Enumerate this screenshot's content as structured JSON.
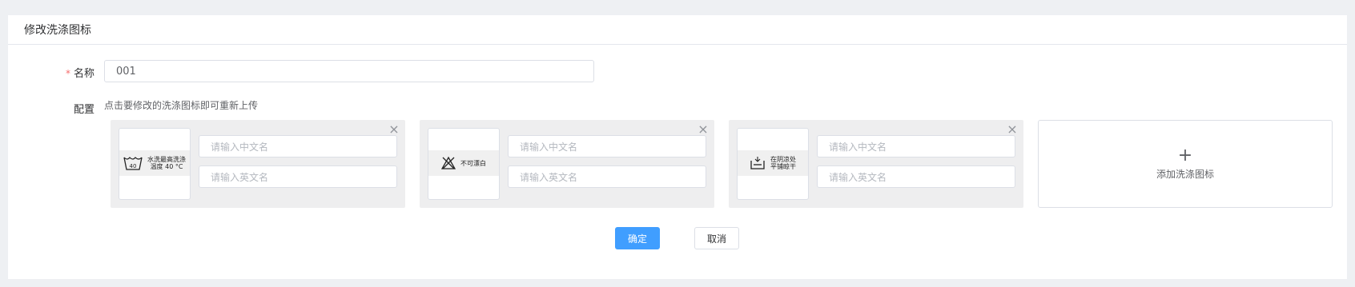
{
  "header": {
    "title": "修改洗涤图标"
  },
  "form": {
    "name_label": "名称",
    "required_mark": "*",
    "name_value": "001",
    "config_label": "配置",
    "config_hint": "点击要修改的洗涤图标即可重新上传"
  },
  "cards": [
    {
      "icon": "wash-40-icon",
      "icon_text_line1": "水洗最高洗涤",
      "icon_text_line2": "温度 40 °C",
      "icon_number": "40",
      "cn_placeholder": "请输入中文名",
      "en_placeholder": "请输入英文名"
    },
    {
      "icon": "no-bleach-icon",
      "icon_text_line1": "不可漂白",
      "icon_text_line2": "",
      "cn_placeholder": "请输入中文名",
      "en_placeholder": "请输入英文名"
    },
    {
      "icon": "dry-flat-shade-icon",
      "icon_text_line1": "在阴凉处",
      "icon_text_line2": "平铺晾干",
      "cn_placeholder": "请输入中文名",
      "en_placeholder": "请输入英文名"
    }
  ],
  "add_card": {
    "label": "添加洗涤图标",
    "icon": "plus-icon"
  },
  "buttons": {
    "ok": "确定",
    "cancel": "取消"
  },
  "colors": {
    "primary": "#409eff",
    "required": "#f56c6c",
    "card_bg": "#eeeeef",
    "page_bg": "#eef0f3"
  }
}
